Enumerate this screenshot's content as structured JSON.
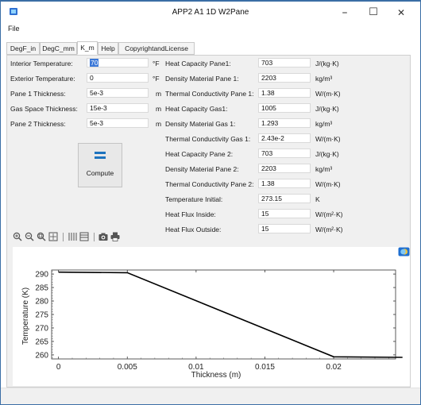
{
  "window": {
    "title": "APP2 A1 1D W2Pane",
    "minimize_glyph": "–",
    "maximize_glyph": "☐",
    "close_glyph": "✕"
  },
  "menu": {
    "file": "File"
  },
  "tabs": [
    {
      "label": "DegF_in",
      "active": false
    },
    {
      "label": "DegC_mm",
      "active": false
    },
    {
      "label": "K_m",
      "active": true
    },
    {
      "label": "Help",
      "active": false
    },
    {
      "label": "CopyrightandLicense",
      "active": false
    }
  ],
  "left_inputs": [
    {
      "label": "Interior Temperature:",
      "value": "70",
      "unit": "°F",
      "selected": true
    },
    {
      "label": "Exterior Temperature:",
      "value": "0",
      "unit": "°F"
    },
    {
      "label": "Pane 1 Thickness:",
      "value": "5e-3",
      "unit": "m"
    },
    {
      "label": "Gas Space Thickness:",
      "value": "15e-3",
      "unit": "m"
    },
    {
      "label": "Pane 2 Thickness:",
      "value": "5e-3",
      "unit": "m"
    }
  ],
  "right_inputs": [
    {
      "label": "Heat Capacity Pane1:",
      "value": "703",
      "unit": "J/(kg·K)"
    },
    {
      "label": "Density Material Pane 1:",
      "value": "2203",
      "unit": "kg/m³"
    },
    {
      "label": "Thermal Conductivity Pane 1:",
      "value": "1.38",
      "unit": "W/(m·K)"
    },
    {
      "label": "Heat Capacity Gas1:",
      "value": "1005",
      "unit": "J/(kg·K)"
    },
    {
      "label": "Density Material Gas 1:",
      "value": "1.293",
      "unit": "kg/m³"
    },
    {
      "label": "Thermal Conductivity Gas 1:",
      "value": "2.43e-2",
      "unit": "W/(m·K)"
    },
    {
      "label": "Heat Capacity Pane 2:",
      "value": "703",
      "unit": "J/(kg·K)"
    },
    {
      "label": "Density Material Pane 2:",
      "value": "2203",
      "unit": "kg/m³"
    },
    {
      "label": "Thermal Conductivity Pane 2:",
      "value": "1.38",
      "unit": "W/(m·K)"
    },
    {
      "label": "Temperature Initial:",
      "value": "273.15",
      "unit": "K"
    },
    {
      "label": "Heat Flux Inside:",
      "value": "15",
      "unit": "W/(m²·K)"
    },
    {
      "label": "Heat Flux Outside:",
      "value": "15",
      "unit": "W/(m²·K)"
    }
  ],
  "compute": {
    "label": "Compute",
    "icon": "equals-icon"
  },
  "plot_toolbar": {
    "icons": [
      "zoom-in-icon",
      "zoom-out-icon",
      "zoom-box-icon",
      "zoom-extents-icon",
      "grid-icon",
      "legend-icon",
      "camera-icon",
      "print-icon"
    ]
  },
  "chart_data": {
    "type": "line",
    "title": "",
    "xlabel": "Thickness (m)",
    "ylabel": "Temperature (K)",
    "xlim": [
      -0.0005,
      0.0245
    ],
    "ylim": [
      258.5,
      291.5
    ],
    "x_ticks": [
      0,
      0.005,
      0.01,
      0.015,
      0.02
    ],
    "x_tick_labels": [
      "0",
      "0.005",
      "0.01",
      "0.015",
      "0.02"
    ],
    "y_ticks": [
      260,
      265,
      270,
      275,
      280,
      285,
      290
    ],
    "y_tick_labels": [
      "260",
      "265",
      "270",
      "275",
      "280",
      "285",
      "290"
    ],
    "grid": false,
    "series": [
      {
        "x": [
          0,
          0.005,
          0.02,
          0.025
        ],
        "y": [
          290.7,
          290.5,
          259.3,
          259.1
        ],
        "color": "#000000"
      }
    ]
  }
}
